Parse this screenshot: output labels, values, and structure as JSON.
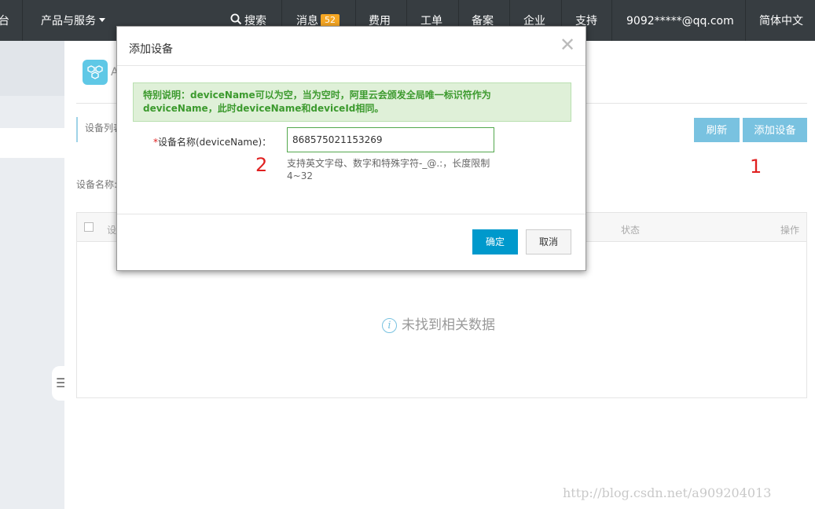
{
  "topbar": {
    "home_fragment": "台",
    "products": "产品与服务",
    "search": "搜索",
    "messages": "消息",
    "message_count": "52",
    "fees": "费用",
    "tickets": "工单",
    "filing": "备案",
    "enterprise": "企业",
    "support": "支持",
    "account": "9092*****@qq.com",
    "language": "简体中文"
  },
  "page": {
    "app_initial": "A",
    "tab_device_list": "设备列表",
    "refresh_button": "刷新",
    "add_device_button": "添加设备",
    "filter_label": "设备名称:",
    "table": {
      "col_device": "设",
      "col_status": "状态",
      "col_actions": "操作"
    },
    "empty_text": "未找到相关数据"
  },
  "annotations": {
    "step1": "1",
    "step2": "2"
  },
  "modal": {
    "title": "添加设备",
    "notice": "特别说明：deviceName可以为空，当为空时，阿里云会颁发全局唯一标识符作为deviceName，此时deviceName和deviceId相同。",
    "field_required_mark": "*",
    "field_label": "设备名称(deviceName)：",
    "field_value": "868575021153269",
    "hint": "支持英文字母、数字和特殊字符-_@.:，长度限制4~32",
    "ok_button": "确定",
    "cancel_button": "取消"
  },
  "watermark": "http://blog.csdn.net/a909204013",
  "colors": {
    "topbar": "#373d41",
    "primary": "#0099cc",
    "light_primary": "#79c2e0",
    "notice_bg": "#dff0d8",
    "notice_text": "#3c9a2e",
    "annotation": "#e02020"
  }
}
